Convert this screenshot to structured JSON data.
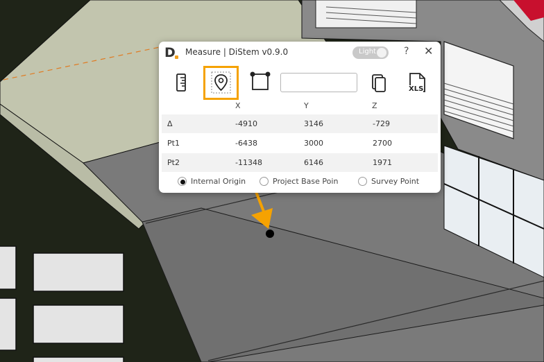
{
  "window": {
    "title": "Measure | DiStem v0.9.0",
    "logo_letter": "D",
    "theme_toggle_label": "Light",
    "help_label": "?",
    "close_label": "✕"
  },
  "toolbar": {
    "tools": [
      {
        "name": "ruler-icon"
      },
      {
        "name": "location-pin-icon",
        "highlighted": true
      },
      {
        "name": "bounding-box-icon"
      },
      {
        "name": "copy-icon"
      },
      {
        "name": "export-xls-icon",
        "label": "XLS"
      }
    ],
    "measure_field_value": ""
  },
  "table": {
    "columns": [
      "X",
      "Y",
      "Z"
    ],
    "rows": [
      {
        "label": "Δ",
        "x": "-4910",
        "y": "3146",
        "z": "-729"
      },
      {
        "label": "Pt1",
        "x": "-6438",
        "y": "3000",
        "z": "2700"
      },
      {
        "label": "Pt2",
        "x": "-11348",
        "y": "6146",
        "z": "1971"
      }
    ]
  },
  "origin_options": [
    {
      "label": "Internal Origin",
      "selected": true
    },
    {
      "label": "Project Base Poin",
      "selected": false
    },
    {
      "label": "Survey Point",
      "selected": false
    }
  ],
  "colors": {
    "highlight": "#f5a201",
    "floor": "#7a7a7a",
    "roof": "#c2c5ae",
    "background": "#1f2418"
  }
}
